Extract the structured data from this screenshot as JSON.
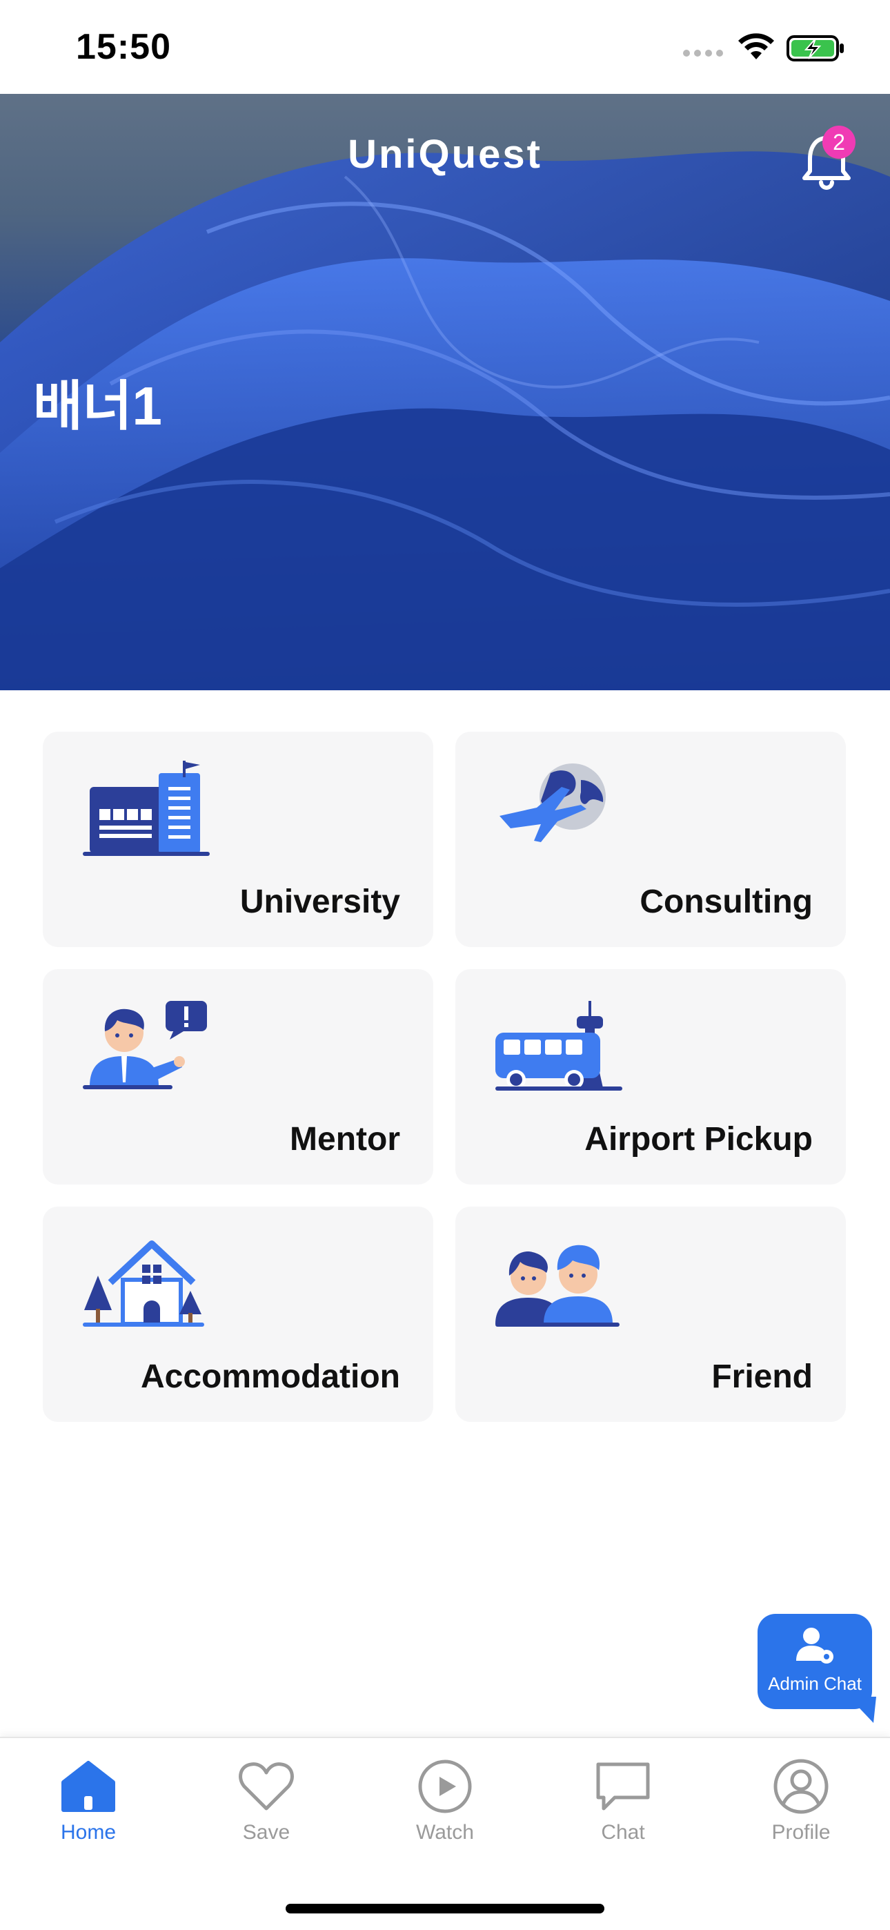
{
  "status_bar": {
    "time": "15:50"
  },
  "header": {
    "title": "UniQuest",
    "notification_count": "2"
  },
  "banner": {
    "label": "배너1"
  },
  "services": [
    {
      "label": "University",
      "icon": "university-building-icon"
    },
    {
      "label": "Consulting",
      "icon": "airplane-globe-icon"
    },
    {
      "label": "Mentor",
      "icon": "mentor-person-icon"
    },
    {
      "label": "Airport Pickup",
      "icon": "bus-airport-icon"
    },
    {
      "label": "Accommodation",
      "icon": "house-icon"
    },
    {
      "label": "Friend",
      "icon": "friends-icon"
    }
  ],
  "admin_chat": {
    "label": "Admin Chat"
  },
  "tabbar": {
    "items": [
      {
        "label": "Home",
        "icon": "home-icon",
        "active": true
      },
      {
        "label": "Save",
        "icon": "heart-icon"
      },
      {
        "label": "Watch",
        "icon": "play-icon"
      },
      {
        "label": "Chat",
        "icon": "chat-bubble-icon"
      },
      {
        "label": "Profile",
        "icon": "profile-icon"
      }
    ]
  },
  "colors": {
    "accent": "#2b74ea",
    "badge": "#f03bb4",
    "card_bg": "#f6f6f7",
    "inactive": "#9a9a9a"
  }
}
